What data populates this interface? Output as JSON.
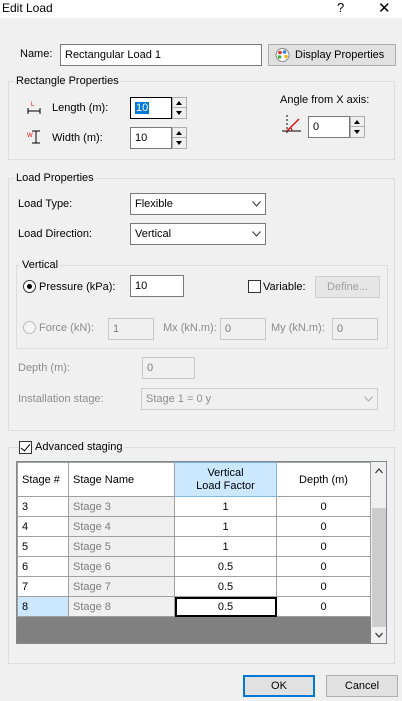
{
  "window": {
    "title": "Edit Load",
    "help": "?",
    "close": "✕"
  },
  "name": {
    "label": "Name:",
    "value": "Rectangular Load 1",
    "display_btn": "Display Properties"
  },
  "rect": {
    "group": "Rectangle Properties",
    "length_label": "Length (m):",
    "length_value": "10",
    "width_label": "Width (m):",
    "width_value": "10",
    "angle_label": "Angle from X axis:",
    "angle_value": "0"
  },
  "load": {
    "group": "Load Properties",
    "type_label": "Load Type:",
    "type_value": "Flexible",
    "dir_label": "Load Direction:",
    "dir_value": "Vertical",
    "vertical_group": "Vertical",
    "pressure_label": "Pressure (kPa):",
    "pressure_value": "10",
    "variable_label": "Variable:",
    "define_btn": "Define...",
    "force_label": "Force (kN):",
    "force_value": "1",
    "mx_label": "Mx (kN.m):",
    "mx_value": "0",
    "my_label": "My (kN.m):",
    "my_value": "0",
    "depth_label": "Depth (m):",
    "depth_value": "0",
    "install_label": "Installation stage:",
    "install_value": "Stage 1 = 0 y"
  },
  "staging": {
    "label": "Advanced staging",
    "headers": [
      "Stage #",
      "Stage Name",
      "Vertical\nLoad Factor",
      "Depth (m)"
    ],
    "header_line1": "Vertical",
    "header_line2": "Load Factor",
    "rows": [
      {
        "num": "3",
        "name": "Stage 3",
        "factor": "1",
        "depth": "0"
      },
      {
        "num": "4",
        "name": "Stage 4",
        "factor": "1",
        "depth": "0"
      },
      {
        "num": "5",
        "name": "Stage 5",
        "factor": "1",
        "depth": "0"
      },
      {
        "num": "6",
        "name": "Stage 6",
        "factor": "0.5",
        "depth": "0"
      },
      {
        "num": "7",
        "name": "Stage 7",
        "factor": "0.5",
        "depth": "0"
      },
      {
        "num": "8",
        "name": "Stage 8",
        "factor": "0.5",
        "depth": "0"
      }
    ]
  },
  "footer": {
    "ok": "OK",
    "cancel": "Cancel"
  },
  "colors": {
    "accent": "#0078d7",
    "selection": "#cce8ff"
  }
}
